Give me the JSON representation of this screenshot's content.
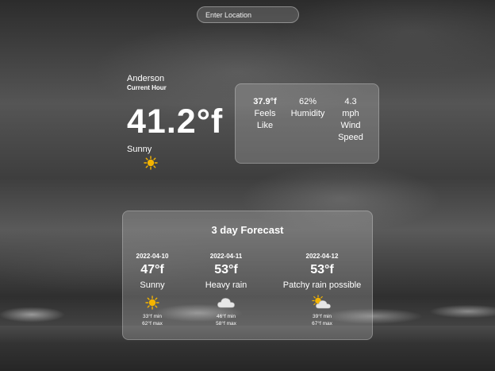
{
  "search": {
    "placeholder": "Enter Location"
  },
  "current": {
    "city": "Anderson",
    "subtitle": "Current Hour",
    "temperature": "41.2°f",
    "condition": "Sunny",
    "icon": "sun-icon"
  },
  "stats": {
    "feels_like": {
      "value": "37.9°f",
      "label": "Feels Like"
    },
    "humidity": {
      "value": "62%",
      "label": "Humidity"
    },
    "wind": {
      "value": "4.3 mph",
      "label": "Wind Speed"
    }
  },
  "forecast": {
    "title": "3 day Forecast",
    "days": [
      {
        "date": "2022-04-10",
        "temp": "47°f",
        "condition": "Sunny",
        "icon": "sun-icon",
        "min": "33°f min",
        "max": "62°f max"
      },
      {
        "date": "2022-04-11",
        "temp": "53°f",
        "condition": "Heavy rain",
        "icon": "cloud-icon",
        "min": "46°f min",
        "max": "58°f max"
      },
      {
        "date": "2022-04-12",
        "temp": "53°f",
        "condition": "Patchy rain possible",
        "icon": "sun-cloud-icon",
        "min": "39°f min",
        "max": "67°f max"
      }
    ]
  },
  "colors": {
    "sun": "#f4b400",
    "cloud": "#e6e6e6"
  }
}
